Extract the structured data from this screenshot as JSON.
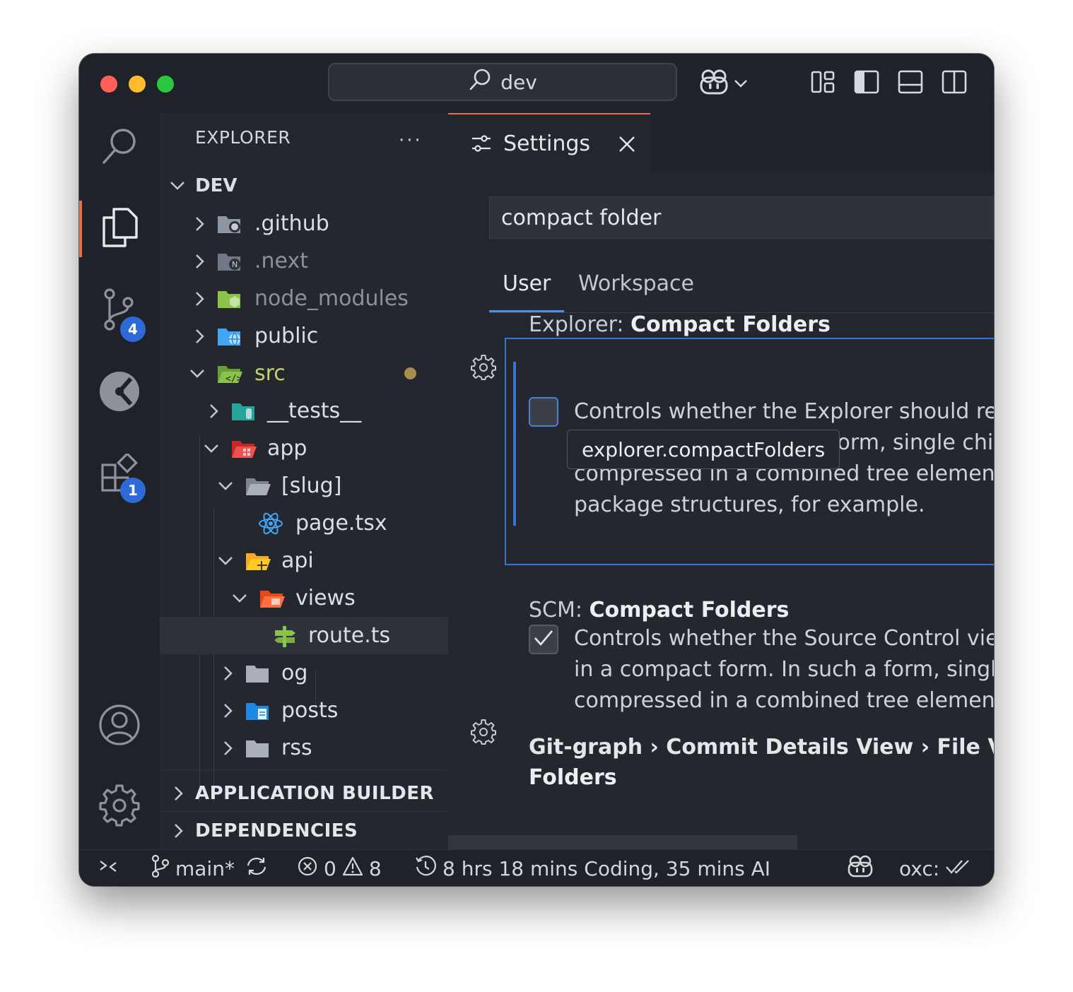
{
  "titlebar": {
    "command_center": "dev",
    "icons": [
      "copilot-icon",
      "chevron-down-icon",
      "customize-layout-icon",
      "toggle-primary-sidebar-icon",
      "toggle-panel-icon",
      "toggle-secondary-sidebar-icon"
    ]
  },
  "activity_bar": {
    "items": [
      {
        "name": "search",
        "icon": "search-icon"
      },
      {
        "name": "explorer",
        "icon": "files-icon",
        "active": true
      },
      {
        "name": "source-control",
        "icon": "source-control-icon",
        "badge": "4"
      },
      {
        "name": "git-graph",
        "icon": "git-graph-icon"
      },
      {
        "name": "extensions",
        "icon": "extensions-icon",
        "badge": "1"
      },
      {
        "name": "accounts",
        "icon": "account-icon"
      },
      {
        "name": "manage",
        "icon": "gear-icon"
      }
    ]
  },
  "sidebar": {
    "title": "EXPLORER",
    "more": "···",
    "root": "DEV",
    "tree": [
      {
        "label": ".github"
      },
      {
        "label": ".next"
      },
      {
        "label": "node_modules"
      },
      {
        "label": "public"
      },
      {
        "label": "src"
      },
      {
        "label": "__tests__"
      },
      {
        "label": "app"
      },
      {
        "label": "[slug]"
      },
      {
        "label": "page.tsx"
      },
      {
        "label": "api"
      },
      {
        "label": "views"
      },
      {
        "label": "route.ts"
      },
      {
        "label": "og"
      },
      {
        "label": "posts"
      },
      {
        "label": "rss"
      }
    ],
    "sections": [
      "APPLICATION BUILDER",
      "DEPENDENCIES"
    ]
  },
  "editor": {
    "tab": {
      "label": "Settings"
    },
    "search_value": "compact folder",
    "scope_tabs": [
      "User",
      "Workspace"
    ],
    "settings": [
      {
        "category": "Explorer: ",
        "title": "Compact Folders",
        "checked": false,
        "description": [
          "Controls whether the Explorer should ren",
          "form, single chil",
          "compressed in a combined tree element.",
          "package structures, for example."
        ],
        "tooltip": "explorer.compactFolders"
      },
      {
        "category": "SCM: ",
        "title": "Compact Folders",
        "checked": true,
        "description": [
          "Controls whether the Source Control viev",
          "in a compact form. In such a form, single",
          "compressed in a combined tree element."
        ]
      },
      {
        "title_line1": "Git-graph › Commit Details View › File View",
        "title_line2": "Folders"
      }
    ]
  },
  "statusbar": {
    "branch": "main*",
    "errors": "0",
    "warnings": "8",
    "time_tracking": "8 hrs 18 mins Coding, 35 mins AI",
    "oxc": "oxc:"
  },
  "colors": {
    "accent": "#e8704f",
    "focus": "#3a71d6",
    "badge": "#2f6bd8",
    "folder_green": "#8bc34a",
    "folder_blue": "#42a5f5",
    "folder_red": "#ef5350",
    "folder_orange": "#ff7043",
    "folder_yellow": "#ffca28"
  }
}
